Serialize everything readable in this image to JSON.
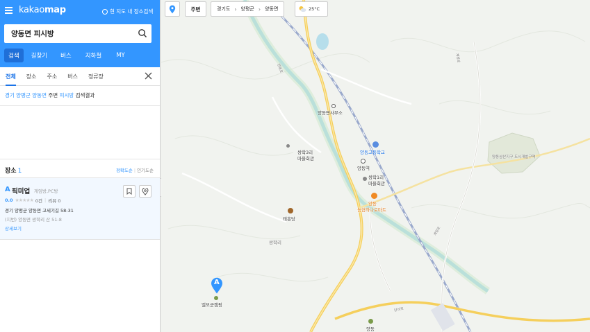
{
  "header": {
    "logo_a": "kakao",
    "logo_b": "map",
    "map_search_toggle": "현 지도 내 장소검색"
  },
  "search": {
    "value": "양동면 피시방"
  },
  "main_tabs": [
    "검색",
    "길찾기",
    "버스",
    "지하철",
    "MY"
  ],
  "sub_tabs": [
    "전체",
    "장소",
    "주소",
    "버스",
    "정류장"
  ],
  "result_summary": {
    "region": "경기 양평군 양동면",
    "middle": "주변",
    "keyword": "피시방",
    "suffix": "검색결과"
  },
  "places": {
    "title": "장소",
    "count": "1",
    "sort_accuracy": "정확도순",
    "sort_popular": "인기도순",
    "items": [
      {
        "letter": "A",
        "name": "픽미업",
        "category": "게임방,PC방",
        "score": "0.0",
        "stars": "★★★★★",
        "review_count": "0건",
        "review_label": "리뷰 0",
        "address": "경기 양평군 양동면 고세기길 58-31",
        "address_jibun": "(지번) 양동면 쌍학리 산 51-8",
        "detail": "상세보기"
      }
    ]
  },
  "map": {
    "around_label": "주변",
    "breadcrumb": [
      "경기도",
      "양평군",
      "양동면"
    ],
    "temperature": "25°C",
    "labels": {
      "office": "양동면사무소",
      "school": "양동고등학교",
      "station": "양동역",
      "ssanghak3": "쌍학3리",
      "ssanghak3_hall": "마을회관",
      "ssanghak1": "쌍학1리",
      "ssanghak1_hall": "마을회관",
      "nonghyup_a": "양동",
      "nonghyup_b": "농협하나로마트",
      "temple": "태흥당",
      "ssanghakri": "쌍학리",
      "district": "양동삼산지구 도시개발구역",
      "camping": "엘모군캠핑",
      "bottom": "양동",
      "road_a": "양동로",
      "road_b": "계정로",
      "road_c": "단석로"
    },
    "marker_letter": "A"
  },
  "colors": {
    "brand": "#3396ff",
    "road_yellow": "#f7d36b",
    "river": "#a8d8ea",
    "rail": "#8fa3c8"
  }
}
